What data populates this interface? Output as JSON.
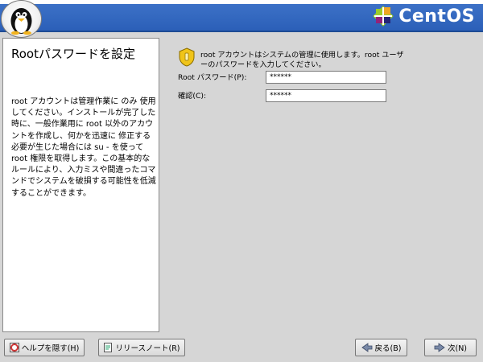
{
  "brand": {
    "name": "CentOS"
  },
  "help": {
    "title": "Rootパスワードを設定",
    "body": "root アカウントは管理作業に のみ 使用してください。インストールが完了した時に、一般作業用に root 以外のアカウントを作成し、何かを迅速に 修正する必要が生じた場合には su - を使って root 権限を取得します。この基本的なルールにより、入力ミスや間違ったコマンドでシステムを破損する可能性を低減することができます。"
  },
  "form": {
    "info": "root アカウントはシステムの管理に使用します。root ユーザーのパスワードを入力してください。",
    "password_label": "Root パスワード(P):",
    "password_value": "******",
    "confirm_label": "確認(C):",
    "confirm_value": "******"
  },
  "buttons": {
    "hide_help": "ヘルプを隠す(H)",
    "release_notes": "リリースノート(R)",
    "back": "戻る(B)",
    "next": "次(N)"
  },
  "icons": {
    "logo": "linux-penguin-icon",
    "brand": "centos-logo-icon",
    "info": "shield-info-icon",
    "hide_help": "help-icon",
    "release_notes": "notes-icon",
    "back": "arrow-left-icon",
    "next": "arrow-right-icon"
  }
}
